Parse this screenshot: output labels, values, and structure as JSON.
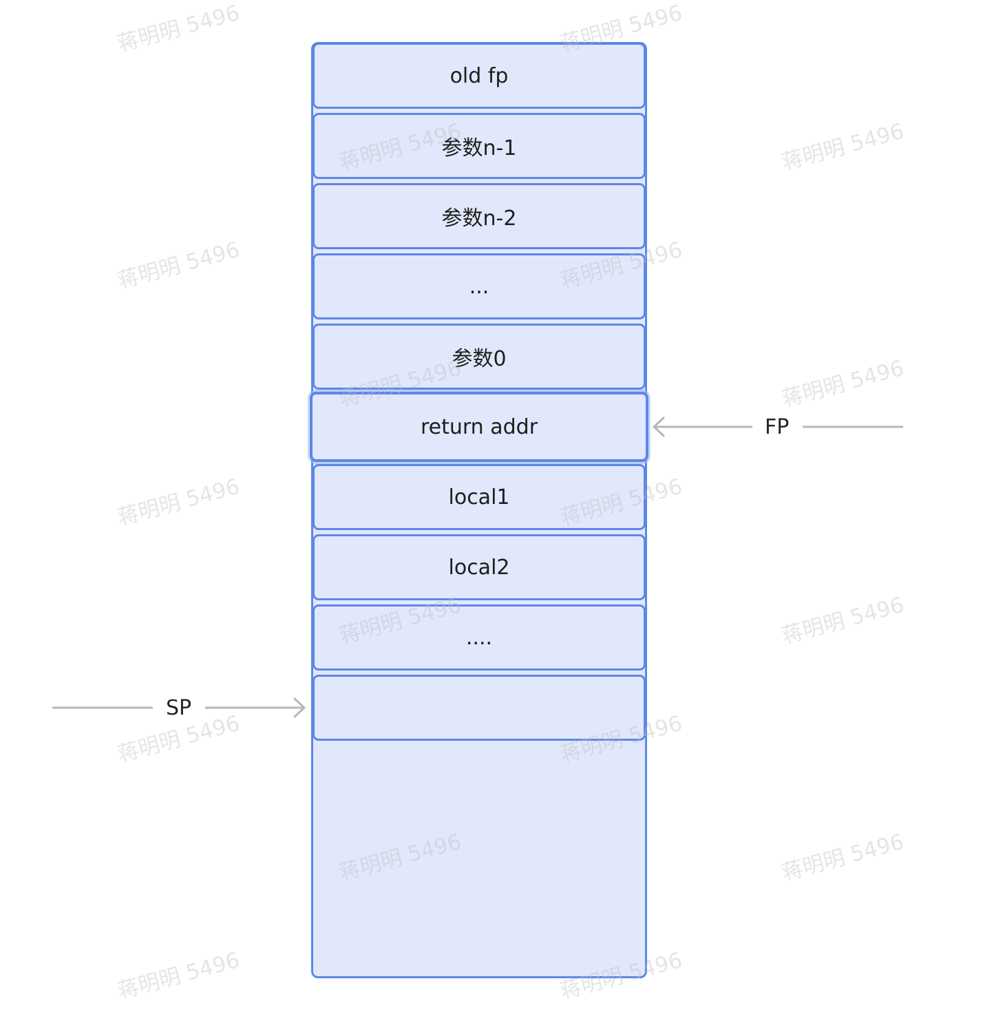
{
  "stack": {
    "slots": [
      {
        "label": "old fp"
      },
      {
        "label": "参数n-1"
      },
      {
        "label": "参数n-2"
      },
      {
        "label": "..."
      },
      {
        "label": "参数0"
      },
      {
        "label": "return addr"
      },
      {
        "label": "local1"
      },
      {
        "label": "local2"
      },
      {
        "label": "...."
      },
      {
        "label": ""
      }
    ]
  },
  "pointers": {
    "fp_label": "FP",
    "sp_label": "SP"
  },
  "watermark": {
    "text": "蒋明明 5496"
  },
  "colors": {
    "slot_fill": "#e1e8fb",
    "slot_border": "#5c87e8",
    "arrow": "#b4b7bb"
  }
}
